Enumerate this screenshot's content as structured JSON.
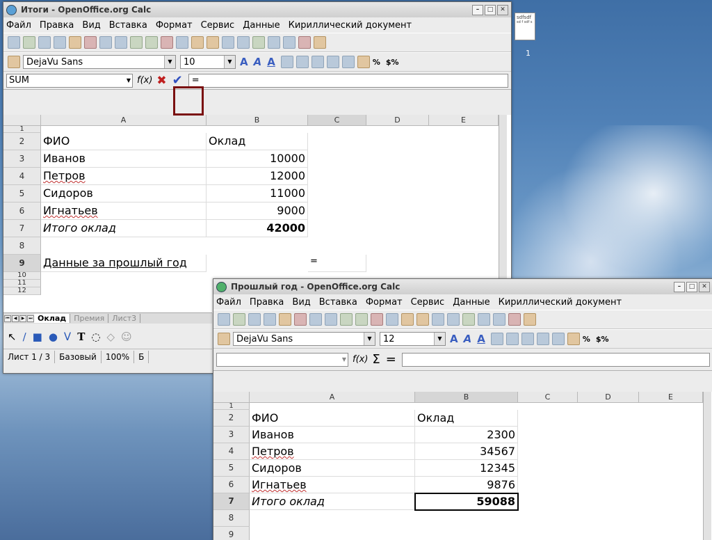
{
  "desktop": {
    "icon_text": "sdfsdf",
    "icon_mini": "sd\nf sdf s",
    "label": "1"
  },
  "w1": {
    "title": "Итоги - OpenOffice.org Calc",
    "menu": [
      "Файл",
      "Правка",
      "Вид",
      "Вставка",
      "Формат",
      "Сервис",
      "Данные",
      "Кириллический документ"
    ],
    "font": "DejaVu Sans",
    "size": "10",
    "namebox": "SUM",
    "formula": "=",
    "columns": [
      "A",
      "B",
      "C",
      "D",
      "E"
    ],
    "rows": [
      "1",
      "2",
      "3",
      "4",
      "5",
      "6",
      "7",
      "8",
      "9",
      "10",
      "11",
      "12"
    ],
    "cells": {
      "a2": "ФИО",
      "b2": "Оклад",
      "a3": "Иванов",
      "b3": "10000",
      "a4": "Петров",
      "b4": "12000",
      "a5": "Сидоров",
      "b5": "11000",
      "a6": "Игнатьев",
      "b6": "9000",
      "a7": "Итого оклад",
      "b7": "42000",
      "a9": "Данные за прошлый год",
      "c9": "="
    },
    "tabs": [
      "Оклад",
      "Премия",
      "Лист3"
    ],
    "status": {
      "sheet": "Лист 1 / 3",
      "style": "Базовый",
      "zoom": "100%",
      "extra": "Б"
    }
  },
  "w2": {
    "title": "Прошлый год - OpenOffice.org Calc",
    "menu": [
      "Файл",
      "Правка",
      "Вид",
      "Вставка",
      "Формат",
      "Сервис",
      "Данные",
      "Кириллический документ"
    ],
    "font": "DejaVu Sans",
    "size": "12",
    "namebox": "",
    "formula": "",
    "columns": [
      "A",
      "B",
      "C",
      "D",
      "E"
    ],
    "rows": [
      "1",
      "2",
      "3",
      "4",
      "5",
      "6",
      "7",
      "8",
      "9"
    ],
    "cells": {
      "a2": "ФИО",
      "b2": "Оклад",
      "a3": "Иванов",
      "b3": "2300",
      "a4": "Петров",
      "b4": "34567",
      "a5": "Сидоров",
      "b5": "12345",
      "a6": "Игнатьев",
      "b6": "9876",
      "a7": "Итого оклад",
      "b7": "59088"
    }
  },
  "symbols": {
    "fx": "f(x)",
    "sigma": "Σ",
    "equals": "=",
    "check": "✔",
    "cancel": "✖",
    "percent": "%",
    "currency": "$%"
  }
}
